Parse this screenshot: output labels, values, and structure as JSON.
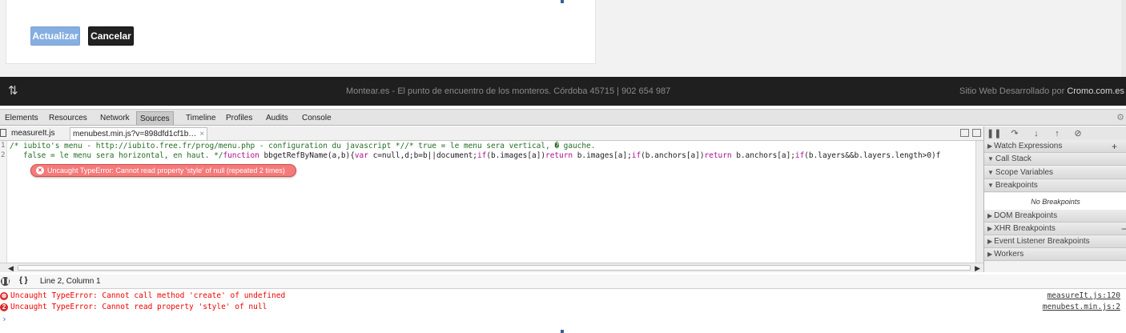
{
  "page": {
    "buttons": {
      "update": "Actualizar",
      "cancel": "Cancelar"
    },
    "footer": {
      "center_text": "Montear.es - El punto de encuentro de los monteros. Córdoba 45715 | 902 654 987",
      "right_prefix": "Sitio Web Desarrollado por ",
      "right_brand": "Cromo.com.es"
    }
  },
  "devtools": {
    "tabs": [
      "Elements",
      "Resources",
      "Network",
      "Sources",
      "Timeline",
      "Profiles",
      "Audits",
      "Console"
    ],
    "active_tab": "Sources",
    "files": [
      {
        "name": "measureIt.js"
      },
      {
        "name": "menubest.min.js?v=898dfd1cf1b…",
        "close": "×"
      }
    ],
    "editor": {
      "lines": [
        {
          "no": "1",
          "comment": "/* iubito's menu - http://iubito.free.fr/prog/menu.php - configuration du javascript *//* true = le menu sera vertical, � gauche."
        },
        {
          "no": "2",
          "comment": "   false = le menu sera horizontal, en haut. */",
          "kw1": "function",
          "code1": " bbgetRefByName(a,b){",
          "kw2": "var",
          "code2": " c=null,d;b=b||document;",
          "kw3": "if",
          "code3": "(b.images[a])",
          "kw4": "return",
          "code4": " b.images[a];",
          "kw5": "if",
          "code5": "(b.anchors[a])",
          "kw6": "return",
          "code6": " b.anchors[a];",
          "kw7": "if",
          "code7": "(b.layers&&b.layers.length>0)f"
        }
      ],
      "error_bubble": "Uncaught TypeError: Cannot read property 'style' of null (repeated 2 times)"
    },
    "sidebar": {
      "panes": [
        "Watch Expressions",
        "Call Stack",
        "Scope Variables",
        "Breakpoints",
        "DOM Breakpoints",
        "XHR Breakpoints",
        "Event Listener Breakpoints",
        "Workers"
      ],
      "no_breakpoints": "No Breakpoints",
      "plus": "+",
      "minus": "−"
    },
    "status": {
      "position": "Line 2, Column 1",
      "pretty_print": "{ }"
    },
    "console": [
      {
        "badge": "⊗",
        "message": "Uncaught TypeError: Cannot call method 'create' of undefined",
        "source": "measureIt.js:120"
      },
      {
        "badge": "2",
        "message": "Uncaught TypeError: Cannot read property 'style' of null",
        "source": "menubest.min.js:2"
      }
    ],
    "prompt": "›"
  },
  "colors": {
    "error": "#e00000",
    "footer_bg": "#1f1f1f",
    "update_button": "#86aee0"
  }
}
